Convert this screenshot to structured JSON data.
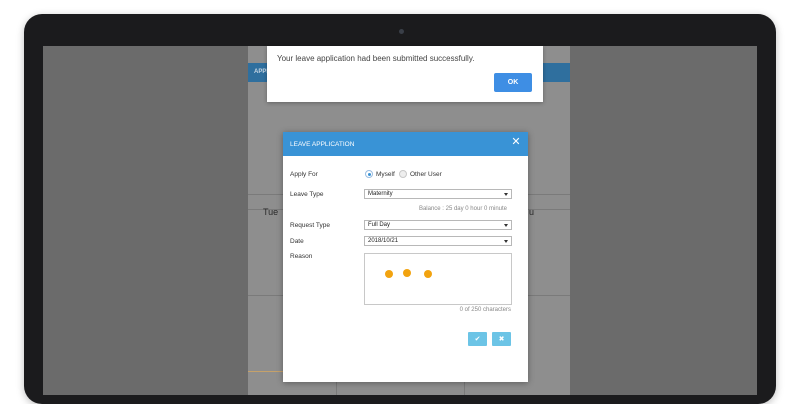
{
  "alert": {
    "message": "Your leave application had been submitted successfully.",
    "ok_label": "OK"
  },
  "background": {
    "header_text": "APPL",
    "day_left": "Tue",
    "day_right": "u"
  },
  "dialog": {
    "title": "LEAVE APPLICATION",
    "close_icon": "close-icon",
    "apply_for": {
      "label": "Apply For",
      "options": [
        "Myself",
        "Other User"
      ],
      "selected": "Myself"
    },
    "leave_type": {
      "label": "Leave Type",
      "value": "Maternity"
    },
    "balance": "Balance : 25 day 0 hour 0 minute",
    "request_type": {
      "label": "Request Type",
      "value": "Full Day"
    },
    "date": {
      "label": "Date",
      "value": "2018/10/21"
    },
    "reason": {
      "label": "Reason",
      "char_count": "0 of 250 characters",
      "loading_icon": "loading-dots-icon"
    },
    "actions": {
      "confirm_icon": "check-icon",
      "cancel_icon": "x-icon"
    }
  },
  "colors": {
    "primary": "#3993d6",
    "ok_button": "#3e8ee4",
    "action_button": "#6cc4e6",
    "loading_dot": "#f2a30f"
  }
}
